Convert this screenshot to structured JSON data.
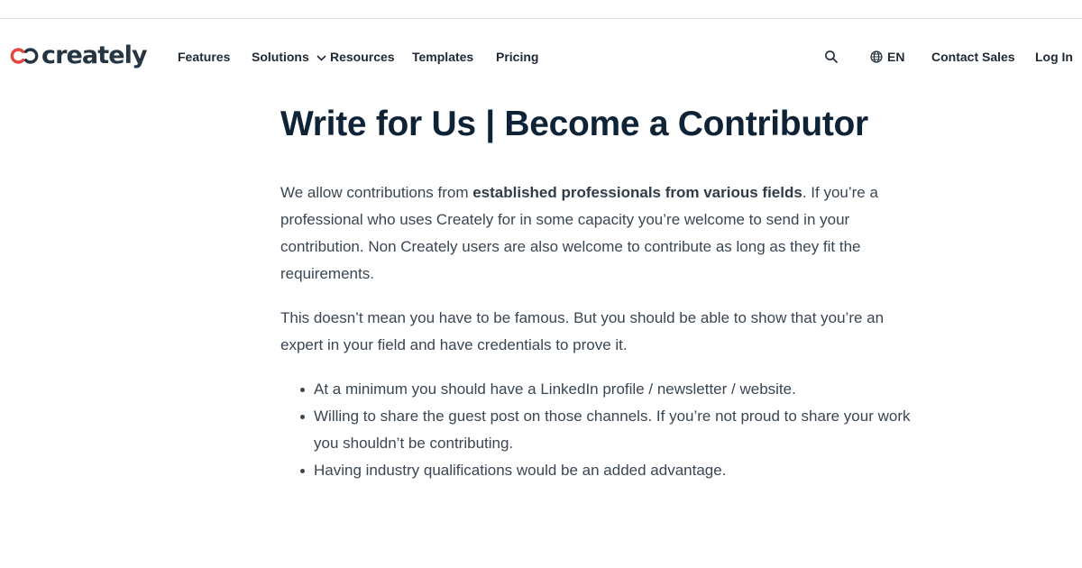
{
  "header": {
    "logo_text": "creately",
    "nav": {
      "features": "Features",
      "solutions": "Solutions",
      "resources": "Resources",
      "templates": "Templates",
      "pricing": "Pricing"
    },
    "search_icon": "search-icon",
    "language": "EN",
    "contact_sales": "Contact Sales",
    "log_in": "Log In"
  },
  "article": {
    "title": "Write for Us | Become a Contributor",
    "p1_before": "We allow contributions from ",
    "p1_bold": "established professionals from various fields",
    "p1_after": ". If you’re a professional who uses Creately for in some capacity you’re welcome to send in your contribution. Non Creately users are also welcome to contribute as long as they fit the requirements.",
    "p2": "This doesn’t mean you have to be famous. But you should be able to show that you’re an expert in your field and have credentials to prove it.",
    "bullets": [
      "At a minimum you should have a LinkedIn profile / newsletter / website.",
      "Willing to share the guest post on those channels. If you’re not proud to share your work you shouldn’t be contributing.",
      "Having industry qualifications would be an added advantage."
    ]
  },
  "colors": {
    "logo_red": "#e8453c",
    "text_dark": "#0f2337",
    "body_text": "#3a4653"
  }
}
